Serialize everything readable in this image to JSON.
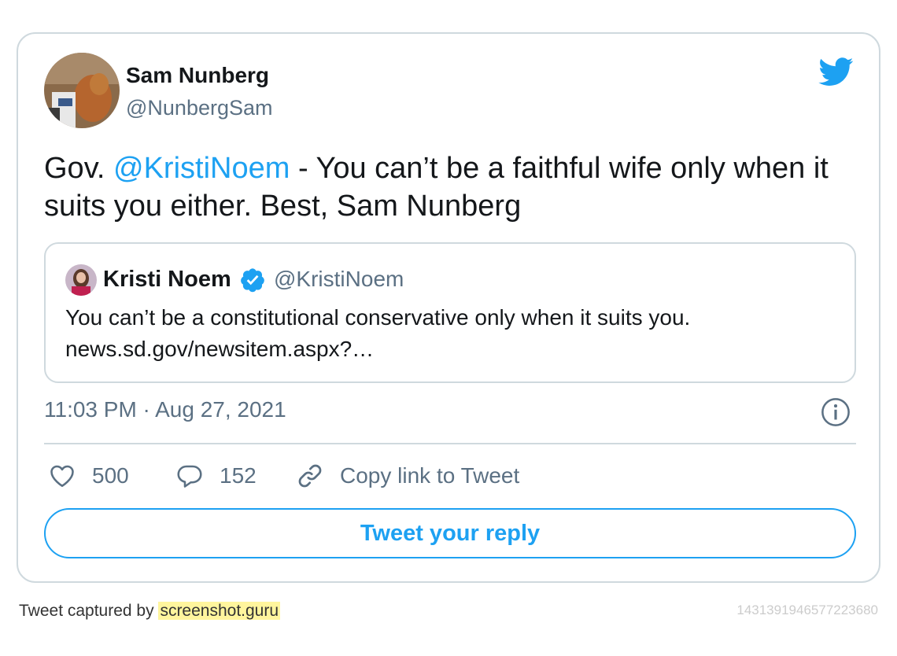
{
  "tweet": {
    "display_name": "Sam Nunberg",
    "handle": "@NunbergSam",
    "text_prefix": "Gov. ",
    "text_mention": "@KristiNoem",
    "text_suffix": " - You can’t be a faithful wife only when it suits you either. Best, Sam Nunberg",
    "timestamp": "11:03 PM · Aug 27, 2021"
  },
  "quoted_tweet": {
    "display_name": "Kristi Noem",
    "handle": "@KristiNoem",
    "verified": true,
    "text_line1": "You can’t be a constitutional conservative only when it suits you.",
    "text_line2": "news.sd.gov/newsitem.aspx?…"
  },
  "actions": {
    "like_count": "500",
    "reply_count": "152",
    "copy_link_label": "Copy link to Tweet"
  },
  "reply_button_label": "Tweet your reply",
  "footer": {
    "captured_by_prefix": "Tweet captured by ",
    "captured_by_site": "screenshot.guru",
    "tweet_id": "1431391946577223680"
  },
  "icons": {
    "brand": "twitter-bird-icon",
    "verified": "verified-badge-icon",
    "info": "info-icon",
    "like": "heart-icon",
    "reply": "speech-bubble-icon",
    "copy": "link-icon"
  },
  "colors": {
    "accent": "#1da1f2",
    "secondary_text": "#5b7083",
    "border": "#cfd9de"
  }
}
